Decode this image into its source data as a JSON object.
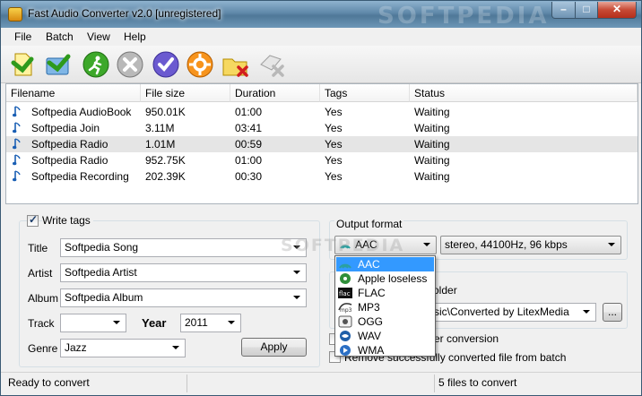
{
  "window": {
    "title": "Fast Audio Converter v2.0 [unregistered]",
    "watermark": "SOFTPEDIA",
    "caption_min": "–",
    "caption_max": "□",
    "caption_close": "✕"
  },
  "menu": [
    "File",
    "Batch",
    "View",
    "Help"
  ],
  "toolbar": [
    "add-files",
    "add-folder",
    "start",
    "stop",
    "check",
    "settings",
    "remove-file",
    "clear-list"
  ],
  "table": {
    "columns": [
      "Filename",
      "File size",
      "Duration",
      "Tags",
      "Status"
    ],
    "rows": [
      [
        "Softpedia AudioBook",
        "950.01K",
        "01:00",
        "Yes",
        "Waiting"
      ],
      [
        "Softpedia Join",
        "3.11M",
        "03:41",
        "Yes",
        "Waiting"
      ],
      [
        "Softpedia Radio",
        "1.01M",
        "00:59",
        "Yes",
        "Waiting"
      ],
      [
        "Softpedia Radio",
        "952.75K",
        "01:00",
        "Yes",
        "Waiting"
      ],
      [
        "Softpedia Recording",
        "202.39K",
        "00:30",
        "Yes",
        "Waiting"
      ]
    ],
    "selected_row": 2
  },
  "tags": {
    "write_tags_label": "Write tags",
    "write_tags_checked": true,
    "title_label": "Title",
    "title_value": "Softpedia Song",
    "artist_label": "Artist",
    "artist_value": "Softpedia Artist",
    "album_label": "Album",
    "album_value": "Softpedia Album",
    "track_label": "Track",
    "track_value": "",
    "year_label": "Year",
    "year_value": "2011",
    "genre_label": "Genre",
    "genre_value": "Jazz",
    "apply_label": "Apply"
  },
  "output": {
    "group_label": "Output format",
    "format_value": "AAC",
    "quality_value": "stereo, 44100Hz, 96 kbps",
    "folder_label_tail": "older",
    "path_tail": "sic\\Converted by LitexMedia",
    "browse_label": "...",
    "after_label_tail": "er conversion",
    "remove_label": "Remove successfully converted file from batch",
    "formats": [
      "AAC",
      "Apple loseless",
      "FLAC",
      "MP3",
      "OGG",
      "WAV",
      "WMA"
    ],
    "highlighted_format": 0,
    "format_icon_labels": [
      "",
      "",
      "flac",
      "mp3",
      "",
      "",
      ""
    ]
  },
  "status": {
    "left": "Ready to convert",
    "right": "5 files to convert"
  },
  "colors": {
    "highlight": "#3399ff",
    "selected_row": "#e5e5e5"
  }
}
